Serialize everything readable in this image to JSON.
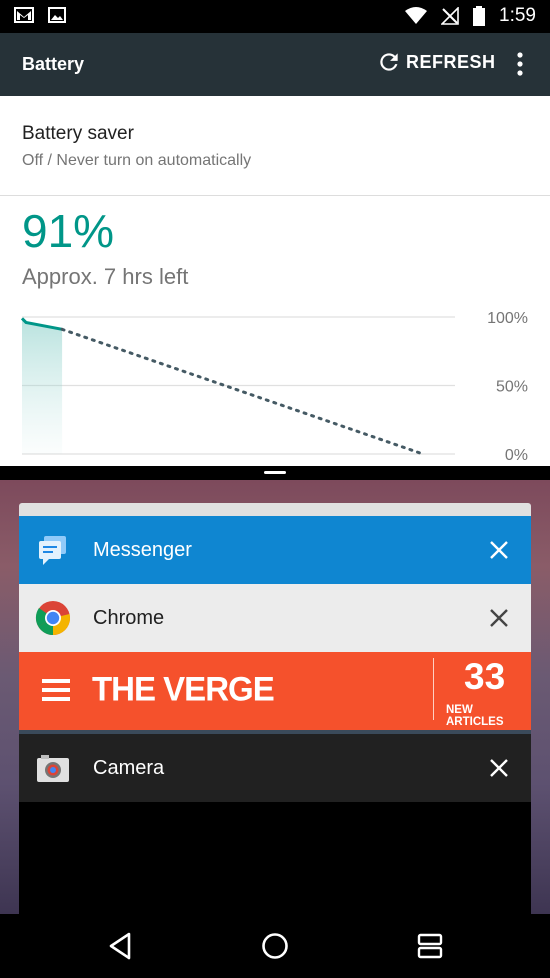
{
  "status_bar": {
    "time": "1:59",
    "icons": [
      "gmail-icon",
      "image-icon",
      "wifi-icon",
      "no-signal-icon",
      "battery-icon"
    ]
  },
  "app_bar": {
    "title": "Battery",
    "refresh_label": "REFRESH",
    "icons": [
      "refresh-icon",
      "overflow-menu-icon"
    ]
  },
  "battery_saver": {
    "title": "Battery saver",
    "subtitle": "Off / Never turn on automatically"
  },
  "battery": {
    "percent": "91%",
    "estimate": "Approx. 7 hrs left"
  },
  "chart_data": {
    "type": "line",
    "x_labels": [],
    "ylim": [
      0,
      100
    ],
    "y_ticks": [
      "100%",
      "50%",
      "0%"
    ],
    "grid": true,
    "series": [
      {
        "style": "solid",
        "points": [
          [
            0,
            99
          ],
          [
            0.1,
            96
          ],
          [
            1,
            91
          ]
        ]
      },
      {
        "style": "dotted",
        "points": [
          [
            1,
            91
          ],
          [
            10,
            0
          ]
        ]
      }
    ],
    "x_max": 10.8
  },
  "recents": {
    "cards": [
      {
        "name": "Messenger",
        "icon": "messenger-icon",
        "header_bg": "#0f86d1",
        "text_color": "#ffffff"
      },
      {
        "name": "Chrome",
        "icon": "chrome-icon",
        "header_bg": "#ececec",
        "text_color": "#212121"
      },
      {
        "name": "Camera",
        "icon": "camera-icon",
        "header_bg": "#212121",
        "text_color": "#ffffff"
      }
    ],
    "verge": {
      "logo": "THE VERGE",
      "count": "33",
      "count_label": "NEW ARTICLES"
    }
  },
  "nav_bar": {
    "buttons": [
      "back-icon",
      "home-icon",
      "recents-split-icon"
    ]
  },
  "colors": {
    "accent": "#009688",
    "app_bar": "#263238",
    "verge_orange": "#f5512c"
  }
}
